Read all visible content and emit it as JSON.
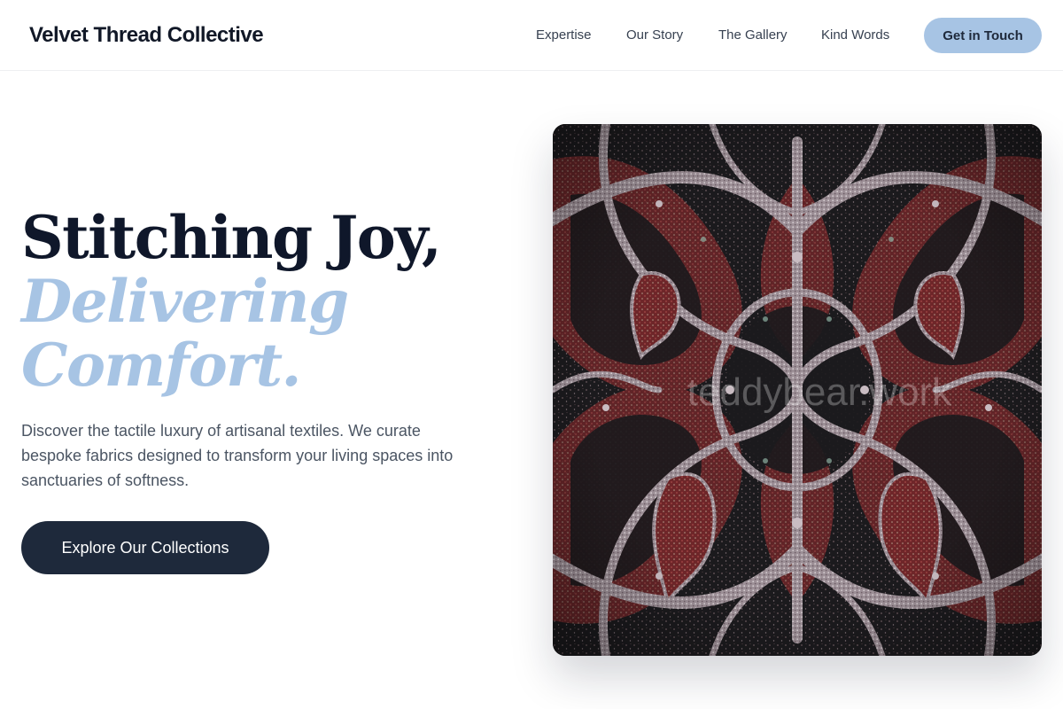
{
  "header": {
    "brand": "Velvet Thread Collective",
    "nav": [
      "Expertise",
      "Our Story",
      "The Gallery",
      "Kind Words"
    ],
    "cta_label": "Get in Touch"
  },
  "hero": {
    "headline_line1": "Stitching Joy,",
    "headline_line2": "Delivering",
    "headline_line3": "Comfort.",
    "subtitle": "Discover the tactile luxury of artisanal textiles. We curate bespoke fabrics designed to transform your living spaces into sanctuaries of softness.",
    "cta_label": "Explore Our Collections",
    "image_watermark": "teddybear.work"
  },
  "colors": {
    "accent": "#a7c4e4",
    "dark": "#1e293b",
    "heading": "#0f172a",
    "body_text": "#4b5563",
    "fabric_base": "#1b1a1d",
    "fabric_red": "#7a2a2c",
    "fabric_thread": "#b9aeb4"
  }
}
